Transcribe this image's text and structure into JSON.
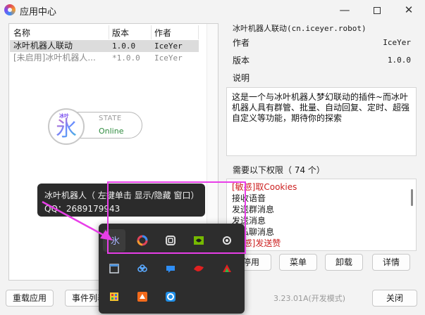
{
  "window": {
    "title": "应用中心",
    "minimize_glyph": "—",
    "close_glyph": "✕"
  },
  "plugin_list": {
    "columns": [
      "名称",
      "版本",
      "作者"
    ],
    "rows": [
      {
        "name": "冰叶机器人联动",
        "version": "1.0.0",
        "author": "IceYer",
        "selected": true,
        "enabled": true
      },
      {
        "name": "[未启用]冰叶机器人...",
        "version": "*1.0.0",
        "author": "IceYer",
        "selected": false,
        "enabled": false
      }
    ]
  },
  "state_widget": {
    "logo_tag": "冰叶",
    "logo_glyph": "氷",
    "label": "STATE",
    "value": "Online",
    "value_color": "#2e8b3e"
  },
  "detail": {
    "plugin_id": "冰叶机器人联动(cn.iceyer.robot)",
    "author_label": "作者",
    "author_value": "IceYer",
    "version_label": "版本",
    "version_value": "1.0.0",
    "desc_label": "说明",
    "description": "这是一个与冰叶机器人梦幻联动的插件~而冰叶机器人具有群管、批量、自动回复、定时、超强自定义等功能，期待你的探索",
    "permissions_title": "需要以下权限（ 74 个）",
    "permissions": [
      {
        "text": "[敏感]取Cookies",
        "sensitive": true
      },
      {
        "text": "接收语音",
        "sensitive": false
      },
      {
        "text": "发送群消息",
        "sensitive": false
      },
      {
        "text": "发送消息",
        "sensitive": false
      },
      {
        "text": "取私聊消息",
        "sensitive": false
      },
      {
        "text": "[敏感]发送赞",
        "sensitive": true
      }
    ]
  },
  "buttons": {
    "disable": "停用",
    "menu": "菜单",
    "uninstall": "卸载",
    "details": "详情",
    "reload": "重载应用",
    "events": "事件列表",
    "close": "关闭"
  },
  "version_text": "3.23.01A(开发模式)",
  "tooltip": {
    "line1": "冰叶机器人（ 左键单击 显示/隐藏 窗口）",
    "line2": "QQ：2689179943"
  },
  "tray": {
    "icons": [
      "iceyer-robot-icon",
      "colorful-ring-icon",
      "network-icon",
      "nvidia-icon",
      "settings-dial-icon",
      "window-icon",
      "cloud-sync-icon",
      "chat-bubble-icon",
      "gaming-mouse-icon",
      "color-triangle-icon",
      "grid-app-icon",
      "orange-app-icon",
      "sync-refresh-icon"
    ]
  },
  "colors": {
    "highlight": "#e83ee8",
    "sensitive_text": "#cc1f1f",
    "tray_background": "#2d2d2d"
  }
}
